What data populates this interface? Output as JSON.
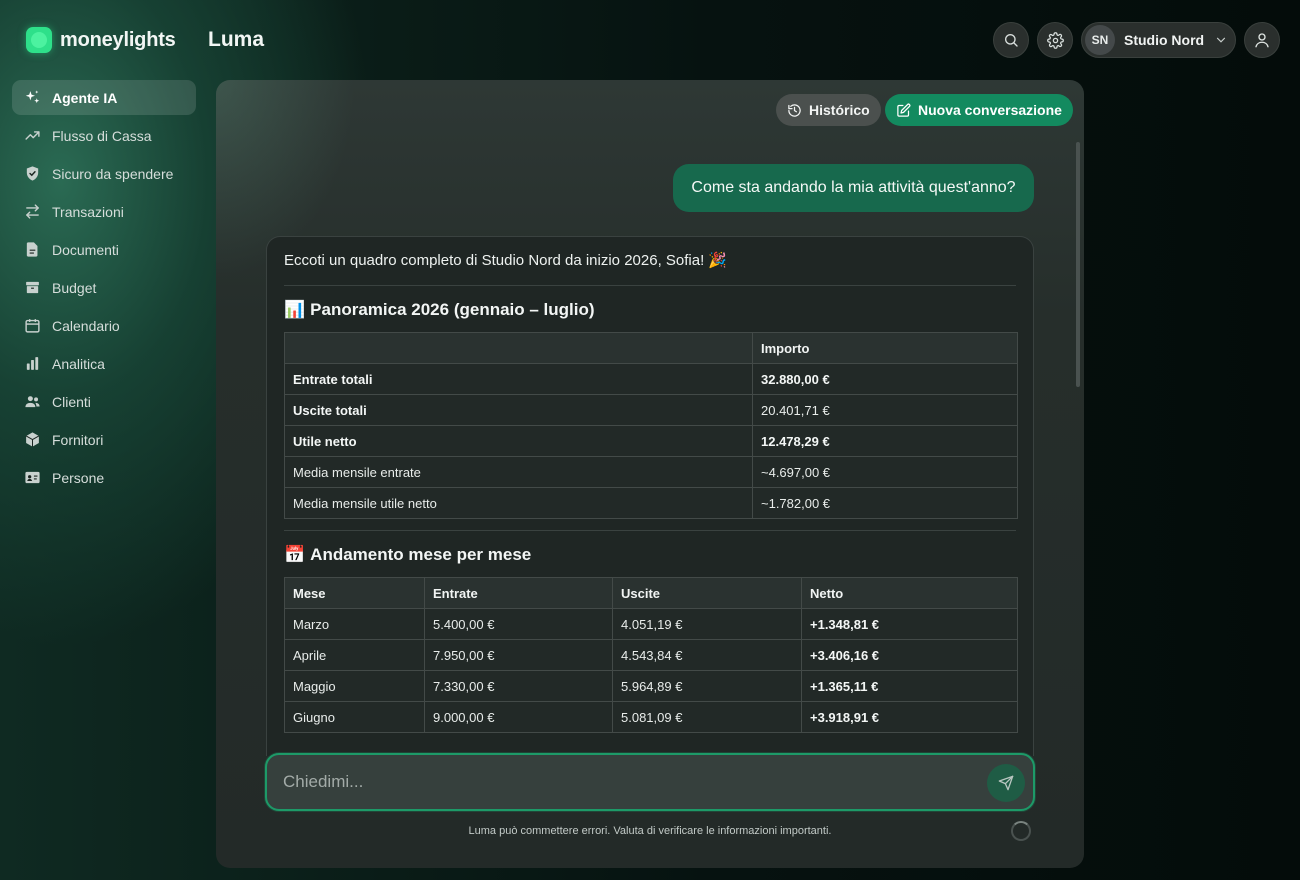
{
  "brand": {
    "name": "moneylights",
    "color": "#2ee08a"
  },
  "app": {
    "title": "Luma"
  },
  "header": {
    "org": {
      "initials": "SN",
      "name": "Studio Nord"
    },
    "icons": [
      "search-icon",
      "gear-icon",
      "chevron-down-icon",
      "user-icon"
    ]
  },
  "sidebar": {
    "items": [
      {
        "label": "Agente IA",
        "icon": "sparkles-icon",
        "active": true
      },
      {
        "label": "Flusso di Cassa",
        "icon": "trend-up-icon"
      },
      {
        "label": "Sicuro da spendere",
        "icon": "shield-check-icon"
      },
      {
        "label": "Transazioni",
        "icon": "arrows-swap-icon"
      },
      {
        "label": "Documenti",
        "icon": "document-icon"
      },
      {
        "label": "Budget",
        "icon": "archive-box-icon"
      },
      {
        "label": "Calendario",
        "icon": "calendar-icon"
      },
      {
        "label": "Analitica",
        "icon": "bar-chart-icon"
      },
      {
        "label": "Clienti",
        "icon": "users-icon"
      },
      {
        "label": "Fornitori",
        "icon": "cube-icon"
      },
      {
        "label": "Persone",
        "icon": "id-card-icon"
      }
    ]
  },
  "chat": {
    "history_label": "Histórico",
    "new_label": "Nuova conversazione",
    "user_message": "Come sta andando la mia attività quest'anno?",
    "assistant": {
      "intro": "Eccoti un quadro completo di Studio Nord da inizio 2026, Sofia! 🎉",
      "section1": {
        "emoji": "📊",
        "title": "Panoramica 2026 (gennaio – luglio)",
        "headers": [
          "",
          "Importo"
        ],
        "rows": [
          {
            "label": "Entrate totali",
            "value": "32.880,00 €",
            "bold": true
          },
          {
            "label": "Uscite totali",
            "value": "20.401,71 €",
            "bold": false,
            "label_bold": true
          },
          {
            "label": "Utile netto",
            "value": "12.478,29 €",
            "bold": true
          },
          {
            "label": "Media mensile entrate",
            "value": "~4.697,00 €",
            "bold": false
          },
          {
            "label": "Media mensile utile netto",
            "value": "~1.782,00 €",
            "bold": false
          }
        ]
      },
      "section2": {
        "emoji": "📅",
        "title": "Andamento mese per mese",
        "headers": [
          "Mese",
          "Entrate",
          "Uscite",
          "Netto"
        ],
        "rows": [
          [
            "Marzo",
            "5.400,00 €",
            "4.051,19 €",
            "+1.348,81 €"
          ],
          [
            "Aprile",
            "7.950,00 €",
            "4.543,84 €",
            "+3.406,16 €"
          ],
          [
            "Maggio",
            "7.330,00 €",
            "5.964,89 €",
            "+1.365,11 €"
          ],
          [
            "Giugno",
            "9.000,00 €",
            "5.081,09 €",
            "+3.918,91 €"
          ]
        ]
      }
    },
    "composer": {
      "placeholder": "Chiedimi..."
    },
    "disclaimer": "Luma può commettere errori. Valuta di verificare le informazioni importanti."
  }
}
